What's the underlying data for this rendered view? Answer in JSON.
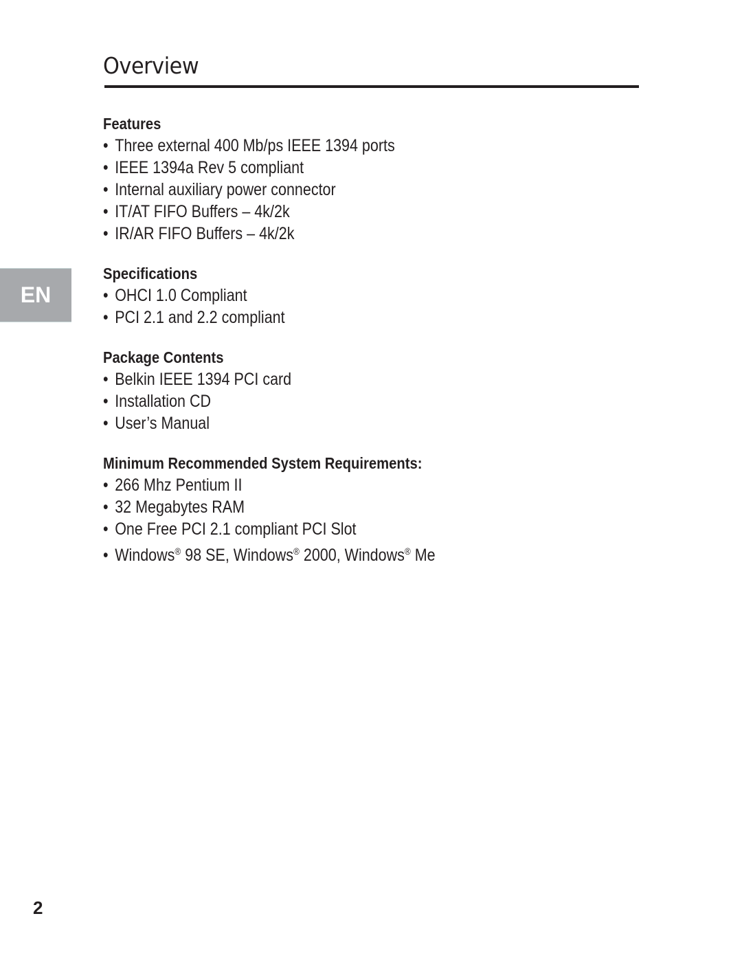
{
  "page": {
    "title": "Overview",
    "language_tab": "EN",
    "page_number": "2"
  },
  "sections": [
    {
      "heading": "Features",
      "items": [
        "Three external 400 Mb/ps IEEE 1394 ports",
        "IEEE 1394a Rev 5 compliant",
        "Internal auxiliary power connector",
        "IT/AT FIFO Buffers – 4k/2k",
        "IR/AR FIFO Buffers – 4k/2k"
      ]
    },
    {
      "heading": "Specifications",
      "items": [
        "OHCI 1.0 Compliant",
        "PCI 2.1 and 2.2 compliant"
      ]
    },
    {
      "heading": "Package Contents",
      "items": [
        "Belkin IEEE 1394 PCI card",
        "Installation CD",
        "User’s Manual"
      ]
    },
    {
      "heading": "Minimum Recommended System Requirements:",
      "items": [
        "266 Mhz Pentium II",
        "32 Megabytes RAM",
        "One Free PCI 2.1 compliant PCI Slot"
      ],
      "windows_item": {
        "w1": "Windows",
        "v1": " 98 SE, ",
        "w2": "Windows",
        "v2": " 2000, ",
        "w3": "Windows",
        "v3": " Me",
        "reg": "®"
      }
    }
  ],
  "bullet": "•"
}
